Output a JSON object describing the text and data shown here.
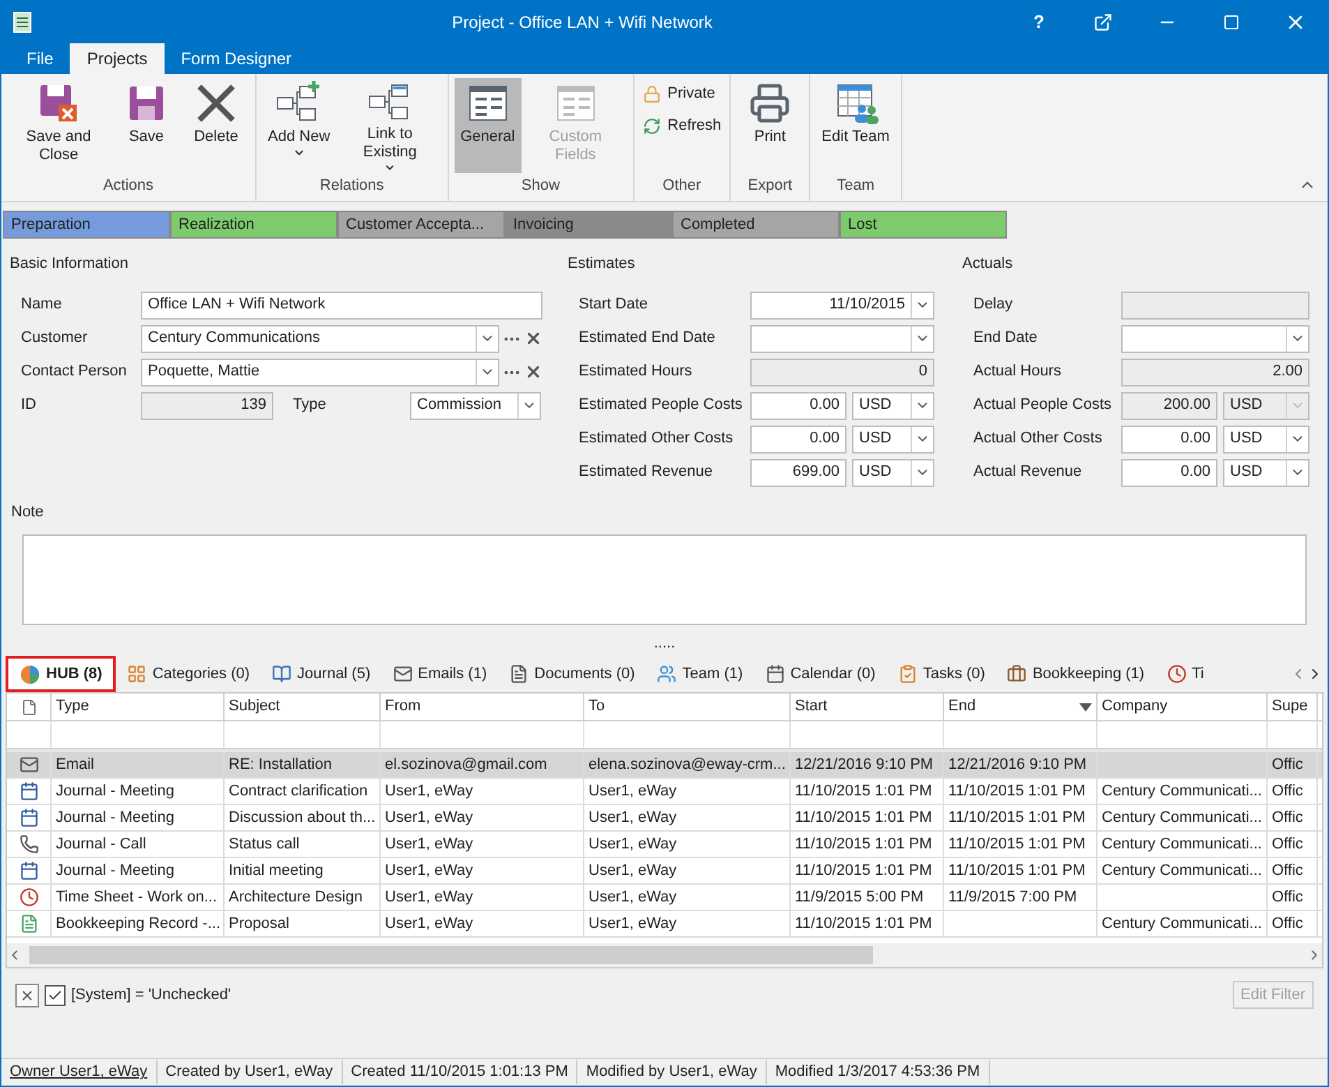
{
  "window": {
    "title": "Project - Office LAN + Wifi Network",
    "help": "?"
  },
  "menu_tabs": [
    {
      "label": "File",
      "selected": false
    },
    {
      "label": "Projects",
      "selected": true
    },
    {
      "label": "Form Designer",
      "selected": false
    }
  ],
  "ribbon": [
    {
      "label": "Actions",
      "buttons": [
        {
          "label": "Save and Close",
          "kind": "save_close",
          "selected": false,
          "disabled": false,
          "dropdown": false
        },
        {
          "label": "Save",
          "kind": "save",
          "selected": false,
          "disabled": false,
          "dropdown": false
        },
        {
          "label": "Delete",
          "kind": "delete",
          "selected": false,
          "disabled": false,
          "dropdown": false
        }
      ]
    },
    {
      "label": "Relations",
      "buttons": [
        {
          "label": "Add New",
          "kind": "add",
          "selected": false,
          "disabled": false,
          "dropdown": true
        },
        {
          "label": "Link to Existing",
          "kind": "link",
          "selected": false,
          "disabled": false,
          "dropdown": true
        }
      ]
    },
    {
      "label": "Show",
      "buttons": [
        {
          "label": "General",
          "kind": "general",
          "selected": true,
          "disabled": false,
          "dropdown": false
        },
        {
          "label": "Custom Fields",
          "kind": "custom",
          "selected": false,
          "disabled": true,
          "dropdown": false
        }
      ]
    },
    {
      "label": "Other",
      "small": [
        {
          "label": "Private",
          "kind": "lock"
        },
        {
          "label": "Refresh",
          "kind": "refresh"
        }
      ]
    },
    {
      "label": "Export",
      "buttons": [
        {
          "label": "Print",
          "kind": "print",
          "selected": false,
          "disabled": false,
          "dropdown": false
        }
      ]
    },
    {
      "label": "Team",
      "buttons": [
        {
          "label": "Edit Team",
          "kind": "team",
          "selected": false,
          "disabled": false,
          "dropdown": false
        }
      ]
    }
  ],
  "stages": [
    {
      "label": "Preparation",
      "color": "#759bdc"
    },
    {
      "label": "Realization",
      "color": "#7ecb6d"
    },
    {
      "label": "Customer Accepta...",
      "color": "#a5a5a5"
    },
    {
      "label": "Invoicing",
      "color": "#8a8a8a"
    },
    {
      "label": "Completed",
      "color": "#a5a5a5"
    },
    {
      "label": "Lost",
      "color": "#7ecb6d"
    }
  ],
  "sections": [
    {
      "title": "Basic Information",
      "fields": [
        {
          "label": "Name",
          "kind": "text",
          "value": "Office LAN + Wifi Network",
          "readonly": false
        },
        {
          "label": "Customer",
          "kind": "lookup",
          "value": "Century Communications",
          "readonly": false
        },
        {
          "label": "Contact Person",
          "kind": "lookup",
          "value": "Poquette, Mattie",
          "readonly": false
        },
        {
          "label": "ID",
          "kind": "id",
          "value": "139",
          "readonly": true,
          "side": {
            "label": "Type",
            "value": "Commission"
          }
        }
      ]
    },
    {
      "title": "Estimates",
      "fields": [
        {
          "label": "Start Date",
          "kind": "date",
          "value": "11/10/2015",
          "readonly": false
        },
        {
          "label": "Estimated End Date",
          "kind": "date",
          "readonly": false
        },
        {
          "label": "Estimated Hours",
          "kind": "number",
          "value": "0",
          "readonly": true
        },
        {
          "label": "Estimated People Costs",
          "kind": "money",
          "value": "0.00",
          "readonly": false,
          "currency": "USD",
          "currency_disabled": false
        },
        {
          "label": "Estimated Other Costs",
          "kind": "money",
          "value": "0.00",
          "readonly": false,
          "currency": "USD",
          "currency_disabled": false
        },
        {
          "label": "Estimated Revenue",
          "kind": "money",
          "value": "699.00",
          "readonly": false,
          "currency": "USD",
          "currency_disabled": false
        }
      ]
    },
    {
      "title": "Actuals",
      "fields": [
        {
          "label": "Delay",
          "kind": "number",
          "readonly": true
        },
        {
          "label": "End Date",
          "kind": "date",
          "readonly": false
        },
        {
          "label": "Actual Hours",
          "kind": "number",
          "value": "2.00",
          "readonly": true
        },
        {
          "label": "Actual People Costs",
          "kind": "money",
          "value": "200.00",
          "readonly": true,
          "currency": "USD",
          "currency_disabled": true
        },
        {
          "label": "Actual Other Costs",
          "kind": "money",
          "value": "0.00",
          "readonly": false,
          "currency": "USD",
          "currency_disabled": false
        },
        {
          "label": "Actual Revenue",
          "kind": "money",
          "value": "0.00",
          "readonly": false,
          "currency": "USD",
          "currency_disabled": false
        }
      ]
    }
  ],
  "note": {
    "label": "Note"
  },
  "splitter": ".....",
  "tabs": [
    {
      "label": "HUB (8)",
      "kind": "hub",
      "selected": true
    },
    {
      "label": "Categories (0)",
      "kind": "categories",
      "selected": false
    },
    {
      "label": "Journal (5)",
      "kind": "journal",
      "selected": false
    },
    {
      "label": "Emails (1)",
      "kind": "email",
      "selected": false
    },
    {
      "label": "Documents (0)",
      "kind": "document",
      "selected": false
    },
    {
      "label": "Team (1)",
      "kind": "team",
      "selected": false
    },
    {
      "label": "Calendar (0)",
      "kind": "calendar",
      "selected": false
    },
    {
      "label": "Tasks (0)",
      "kind": "tasks",
      "selected": false
    },
    {
      "label": "Bookkeeping (1)",
      "kind": "bookkeeping",
      "selected": false
    },
    {
      "label": "Ti",
      "kind": "timesheet",
      "selected": false
    }
  ],
  "table": {
    "columns": [
      {
        "label": "Type",
        "sorted": false
      },
      {
        "label": "Subject",
        "sorted": false
      },
      {
        "label": "From",
        "sorted": false
      },
      {
        "label": "To",
        "sorted": false
      },
      {
        "label": "Start",
        "sorted": false
      },
      {
        "label": "End",
        "sorted": true
      },
      {
        "label": "Company",
        "sorted": false
      },
      {
        "label": "Supe",
        "sorted": false
      }
    ],
    "rows": [
      {
        "kind": "email",
        "selected": true,
        "cells": [
          "Email",
          "RE: Installation",
          "el.sozinova@gmail.com",
          "elena.sozinova@eway-crm...",
          "12/21/2016 9:10 PM",
          "12/21/2016 9:10 PM",
          "",
          "Offic"
        ]
      },
      {
        "kind": "meeting",
        "selected": false,
        "cells": [
          "Journal - Meeting",
          "Contract clarification",
          "User1, eWay",
          "User1, eWay",
          "11/10/2015 1:01 PM",
          "11/10/2015 1:01 PM",
          "Century Communicati...",
          "Offic"
        ]
      },
      {
        "kind": "meeting",
        "selected": false,
        "cells": [
          "Journal - Meeting",
          "Discussion about th...",
          "User1, eWay",
          "User1, eWay",
          "11/10/2015 1:01 PM",
          "11/10/2015 1:01 PM",
          "Century Communicati...",
          "Offic"
        ]
      },
      {
        "kind": "call",
        "selected": false,
        "cells": [
          "Journal - Call",
          "Status call",
          "User1, eWay",
          "User1, eWay",
          "11/10/2015 1:01 PM",
          "11/10/2015 1:01 PM",
          "Century Communicati...",
          "Offic"
        ]
      },
      {
        "kind": "meeting",
        "selected": false,
        "cells": [
          "Journal - Meeting",
          "Initial meeting",
          "User1, eWay",
          "User1, eWay",
          "11/10/2015 1:01 PM",
          "11/10/2015 1:01 PM",
          "Century Communicati...",
          "Offic"
        ]
      },
      {
        "kind": "timesheet",
        "selected": false,
        "cells": [
          "Time Sheet - Work on...",
          "Architecture Design",
          "User1, eWay",
          "User1, eWay",
          "11/9/2015 5:00 PM",
          "11/9/2015 7:00 PM",
          "",
          "Offic"
        ]
      },
      {
        "kind": "bookkeeping",
        "selected": false,
        "cells": [
          "Bookkeeping Record -...",
          "Proposal",
          "User1, eWay",
          "User1, eWay",
          "11/10/2015 1:01 PM",
          "",
          "Century Communicati...",
          "Offic"
        ]
      }
    ]
  },
  "filter": {
    "checked": true,
    "text": "[System] = 'Unchecked'",
    "button": "Edit Filter",
    "button_disabled": true
  },
  "status_bar": [
    {
      "kind": "link",
      "text": "Owner User1, eWay"
    },
    {
      "kind": "text",
      "text": "Created by User1, eWay"
    },
    {
      "kind": "text",
      "text": "Created 11/10/2015 1:01:13 PM"
    },
    {
      "kind": "text",
      "text": "Modified by User1, eWay"
    },
    {
      "kind": "text",
      "text": "Modified 1/3/2017 4:53:36 PM"
    }
  ]
}
